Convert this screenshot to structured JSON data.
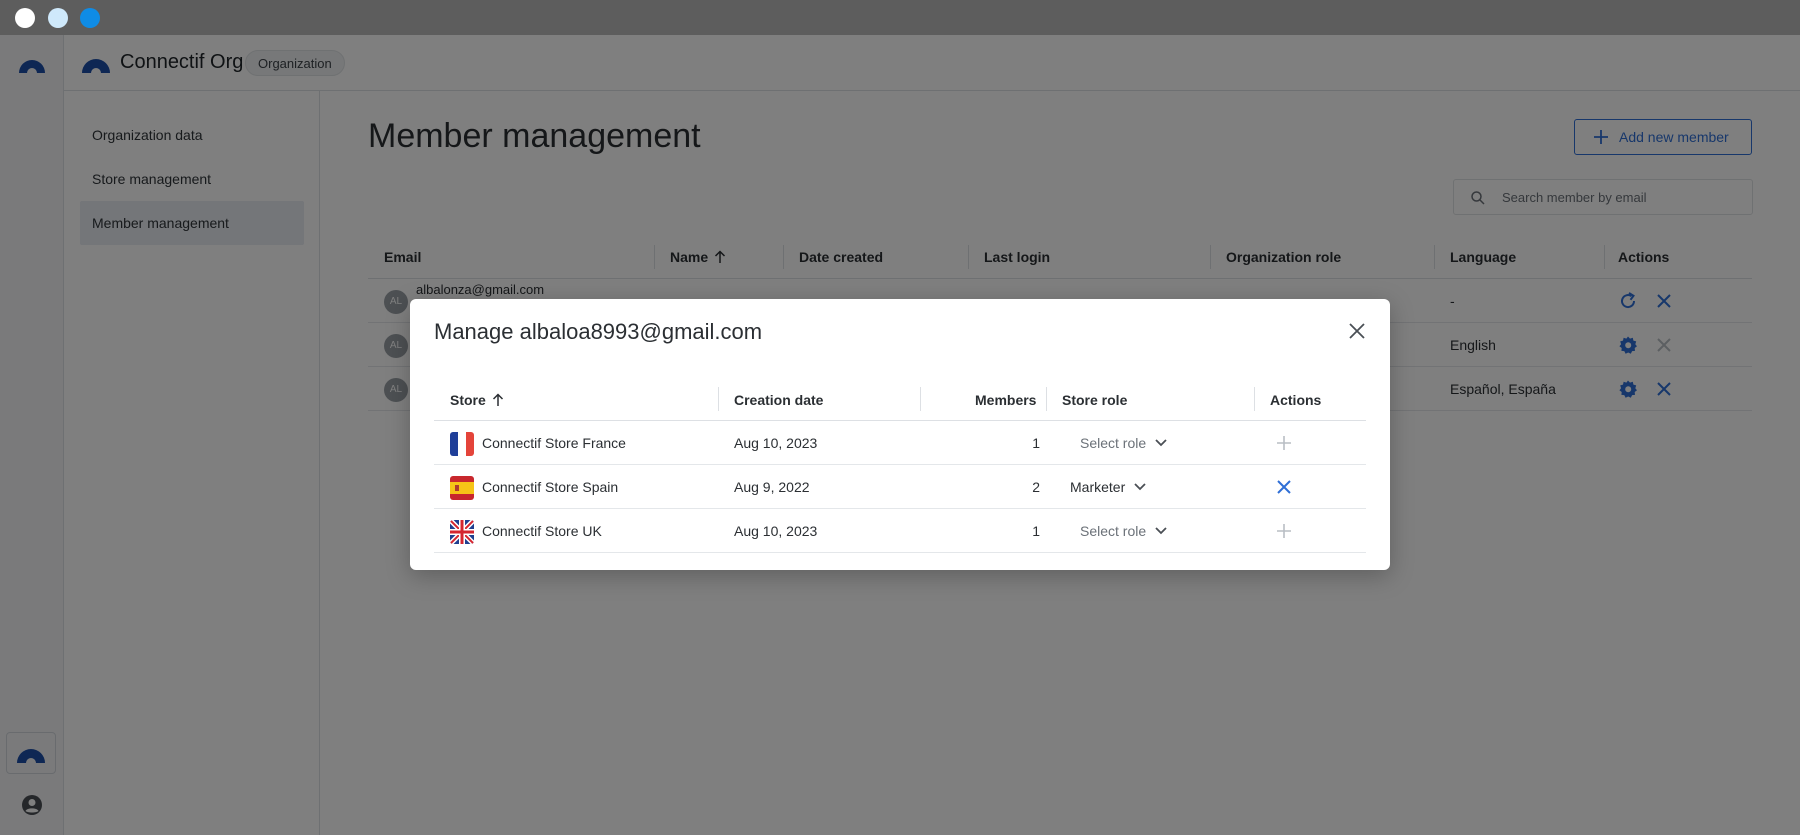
{
  "app": {
    "brand": "Connectif Org",
    "tag": "Organization"
  },
  "subnav": {
    "items": [
      {
        "label": "Organization data",
        "active": false
      },
      {
        "label": "Store management",
        "active": false
      },
      {
        "label": "Member management",
        "active": true
      }
    ]
  },
  "page": {
    "title": "Member management",
    "add_button": "Add new member",
    "search_placeholder": "Search member by email"
  },
  "members_table": {
    "headers": [
      "Email",
      "Name",
      "Date created",
      "Last login",
      "Organization role",
      "Language",
      "Actions"
    ],
    "rows": [
      {
        "avatar": "AL",
        "email": "albalonza@gmail.com",
        "language": "-"
      },
      {
        "avatar": "AL",
        "email": "",
        "language": "English"
      },
      {
        "avatar": "AL",
        "email": "",
        "language": "Español, España"
      }
    ]
  },
  "modal": {
    "title": "Manage albaloa8993@gmail.com",
    "headers": [
      "Store",
      "Creation date",
      "Members",
      "Store role",
      "Actions"
    ],
    "rows": [
      {
        "flag": "france-flag-icon",
        "store": "Connectif Store France",
        "creation_date": "Aug 10, 2023",
        "members": "1",
        "role": "Select role",
        "role_set": false,
        "action": "add-icon"
      },
      {
        "flag": "spain-flag-icon",
        "store": "Connectif Store Spain",
        "creation_date": "Aug 9, 2022",
        "members": "2",
        "role": "Marketer",
        "role_set": true,
        "action": "remove-icon"
      },
      {
        "flag": "uk-flag-icon",
        "store": "Connectif Store UK",
        "creation_date": "Aug 10, 2023",
        "members": "1",
        "role": "Select role",
        "role_set": false,
        "action": "add-icon"
      }
    ]
  },
  "colors": {
    "accent": "#2f6fd6",
    "overlay": "#000000"
  }
}
